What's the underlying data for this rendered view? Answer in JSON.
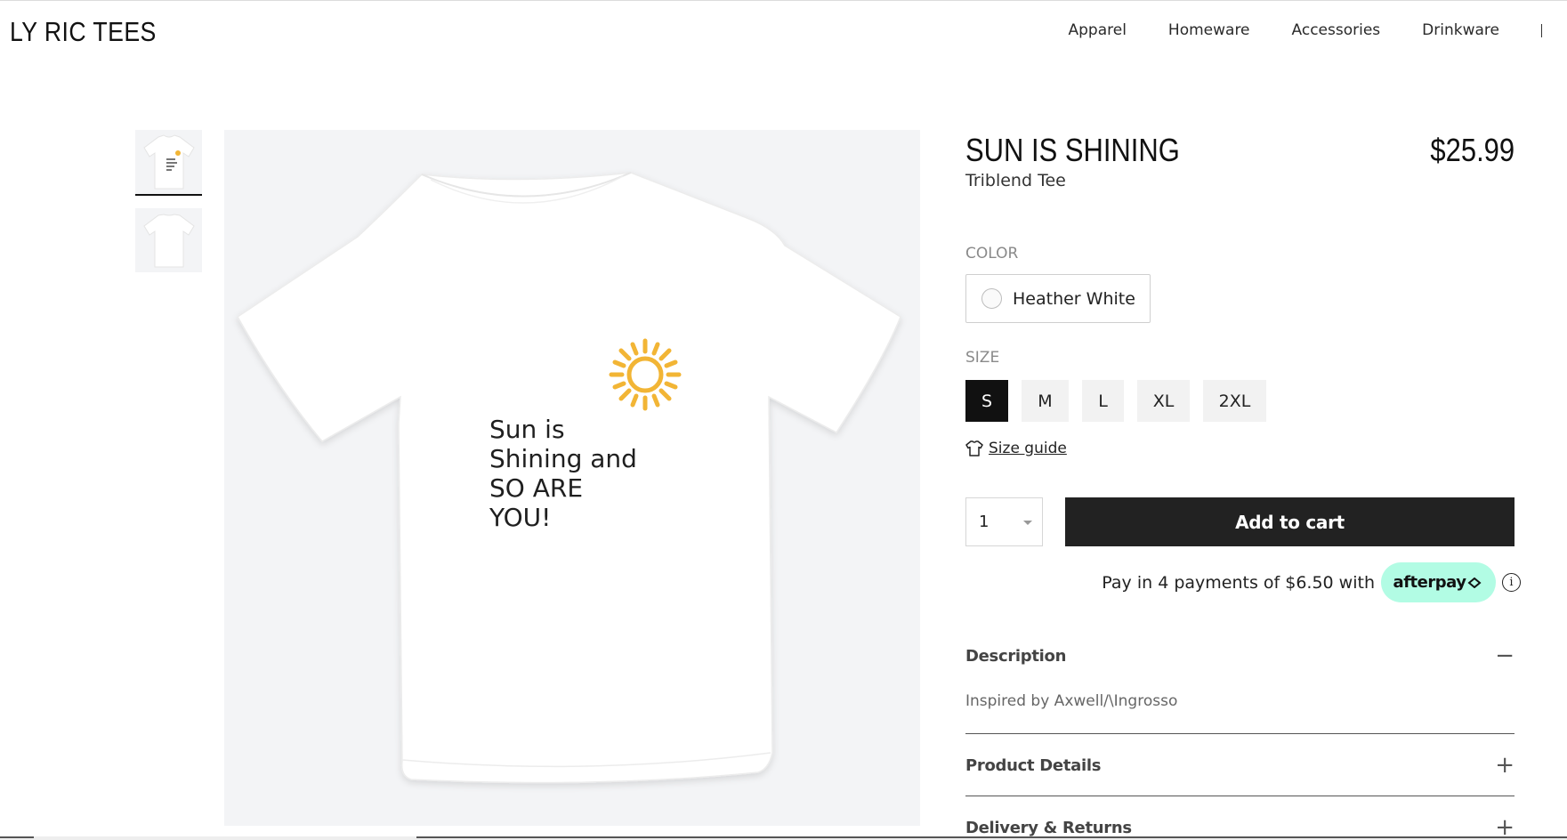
{
  "header": {
    "logo": "LY RIC TEES",
    "nav": [
      "Apparel",
      "Homeware",
      "Accessories",
      "Drinkware"
    ]
  },
  "gallery": {
    "print_text": "Sun is\nShining and\nSO ARE\nYOU!",
    "sun_color": "#f2b535",
    "background": "#f3f4f6"
  },
  "product": {
    "title": "SUN IS SHINING",
    "price": "$25.99",
    "subtitle": "Triblend Tee",
    "color_label": "COLOR",
    "color_value": "Heather White",
    "size_label": "SIZE",
    "sizes": [
      "S",
      "M",
      "L",
      "XL",
      "2XL"
    ],
    "selected_size": "S",
    "size_guide": "Size guide",
    "quantity": "1",
    "add_to_cart": "Add to cart",
    "afterpay_text": "Pay in 4 payments of $6.50 with",
    "afterpay_brand": "afterpay",
    "afterpay_color": "#b2fce4",
    "info_icon": "i"
  },
  "accordions": [
    {
      "title": "Description",
      "symbol": "−",
      "body": "Inspired by Axwell/\\Ingrosso"
    },
    {
      "title": "Product Details",
      "symbol": "+"
    },
    {
      "title": "Delivery & Returns",
      "symbol": "+"
    }
  ]
}
